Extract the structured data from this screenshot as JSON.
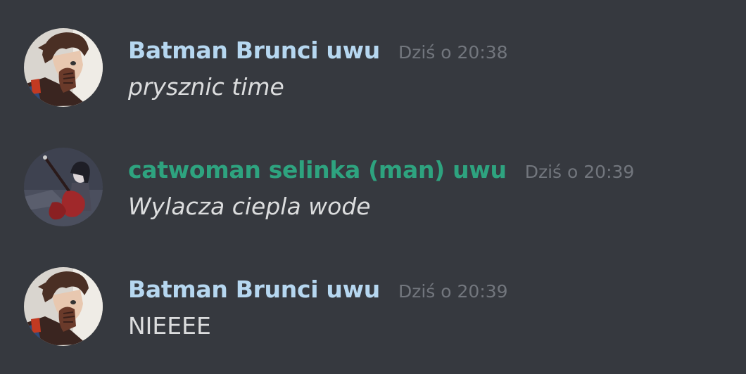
{
  "messages": [
    {
      "author": "Batman Brunci uwu",
      "author_color": "#b6d7f0",
      "timestamp": "Dziś o 20:38",
      "text": "prysznic time",
      "italic": true,
      "avatar_icon": "anime-man-avatar-icon"
    },
    {
      "author": "catwoman selinka (man) uwu",
      "author_color": "#2ea37f",
      "timestamp": "Dziś o 20:39",
      "text": "Wylacza ciepla wode",
      "italic": true,
      "avatar_icon": "guitarist-avatar-icon"
    },
    {
      "author": "Batman Brunci uwu",
      "author_color": "#b6d7f0",
      "timestamp": "Dziś o 20:39",
      "text": "NIEEEE",
      "italic": false,
      "avatar_icon": "anime-man-avatar-icon"
    }
  ],
  "colors": {
    "background": "#36393f",
    "timestamp": "#72767d",
    "message_text": "#dcddde"
  }
}
